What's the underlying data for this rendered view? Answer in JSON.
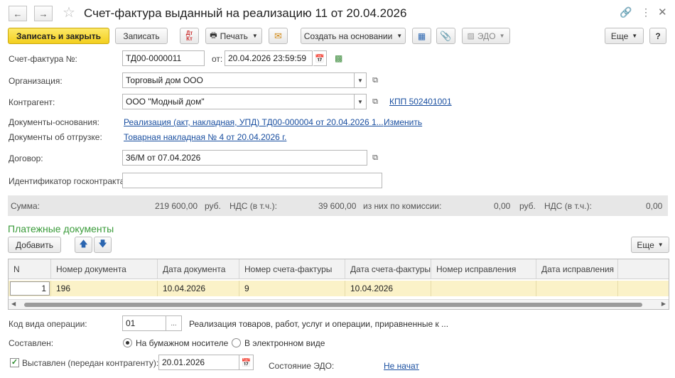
{
  "header": {
    "title": "Счет-фактура выданный на реализацию 11 от 20.04.2026"
  },
  "toolbar": {
    "save_close": "Записать и закрыть",
    "save": "Записать",
    "print": "Печать",
    "create_based": "Создать на основании",
    "edo": "ЭДО",
    "more": "Еще",
    "help": "?",
    "dtkt_icon_top": "Дт",
    "dtkt_icon_bottom": "Кт"
  },
  "form": {
    "invoice_label": "Счет-фактура №:",
    "invoice_number": "ТД00-0000011",
    "date_label": "от:",
    "date_value": "20.04.2026 23:59:59",
    "org_label": "Организация:",
    "org_value": "Торговый дом ООО",
    "contractor_label": "Контрагент:",
    "contractor_value": "ООО \"Модный дом\"",
    "kpp_link": "КПП 502401001",
    "base_docs_label": "Документы-основания:",
    "base_docs_link": "Реализация (акт, накладная, УПД) ТД00-000004 от 20.04.2026 1...",
    "change_link": "Изменить",
    "ship_docs_label": "Документы об отгрузке:",
    "ship_docs_link": "Товарная накладная № 4 от 20.04.2026 г.",
    "contract_label": "Договор:",
    "contract_value": "36/М от 07.04.2026",
    "gov_id_label": "Идентификатор госконтракта:",
    "gov_id_value": ""
  },
  "summary": {
    "sum_label": "Сумма:",
    "sum_value": "219 600,00",
    "currency1": "руб.",
    "vat_label": "НДС (в т.ч.):",
    "vat_value": "39 600,00",
    "commission_label": "из них по комиссии:",
    "commission_value": "0,00",
    "currency2": "руб.",
    "vat2_label": "НДС (в т.ч.):",
    "vat2_value": "0,00"
  },
  "payments": {
    "title": "Платежные документы",
    "add_button": "Добавить",
    "more": "Еще",
    "columns": [
      "N",
      "Номер документа",
      "Дата документа",
      "Номер счета-фактуры",
      "Дата счета-фактуры",
      "Номер исправления",
      "Дата исправления"
    ],
    "rows": [
      [
        "1",
        "196",
        "10.04.2026",
        "9",
        "10.04.2026",
        "",
        ""
      ]
    ]
  },
  "bottom": {
    "op_code_label": "Код вида операции:",
    "op_code_value": "01",
    "op_code_desc": "Реализация товаров, работ, услуг и операции, приравненные к ...",
    "composed_label": "Составлен:",
    "paper_option": "На бумажном носителе",
    "electronic_option": "В электронном виде",
    "issued_label": "Выставлен (передан контрагенту):",
    "issued_date": "20.01.2026",
    "edo_state_label": "Состояние ЭДО:",
    "edo_state_link": "Не начат"
  },
  "colors": {
    "primary_button": "#f3cf1e",
    "link": "#1a4fa0",
    "section_title": "#3a9b3a",
    "selected_row": "#fbf2c8"
  }
}
